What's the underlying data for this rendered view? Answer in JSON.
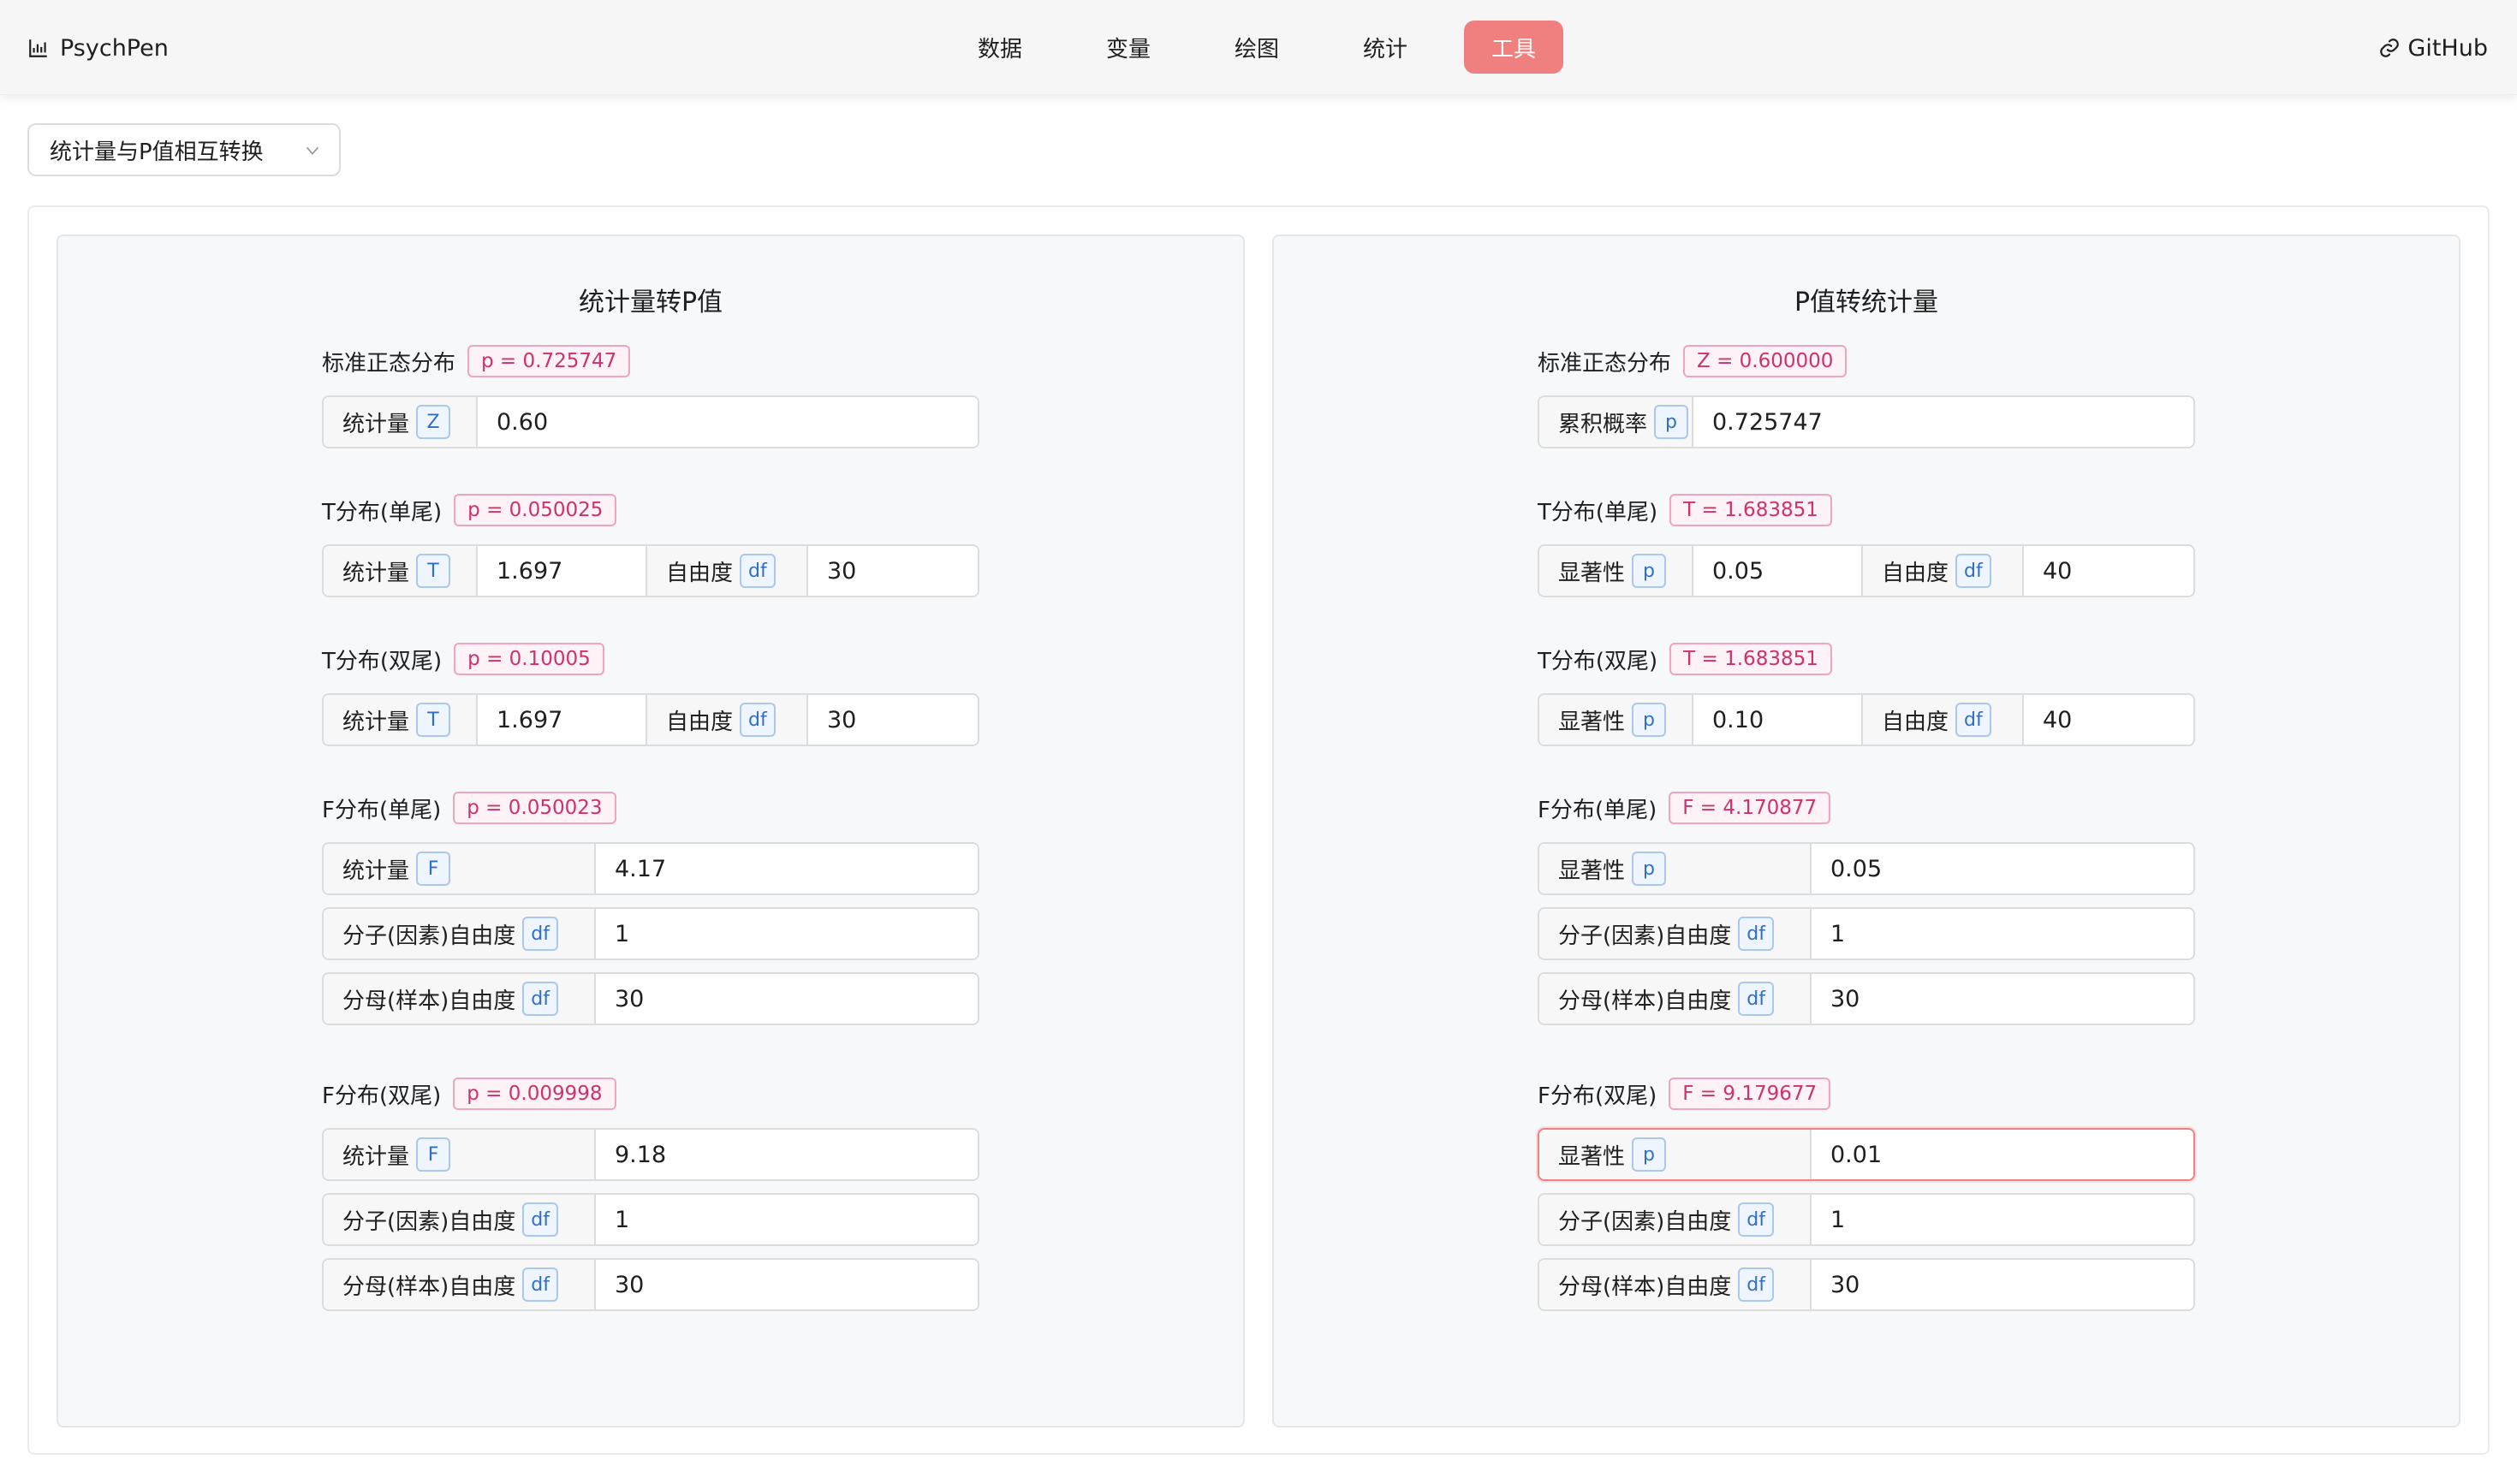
{
  "app": {
    "brand": "PsychPen",
    "github_label": "GitHub"
  },
  "nav": {
    "items": [
      {
        "label": "数据",
        "active": false
      },
      {
        "label": "变量",
        "active": false
      },
      {
        "label": "绘图",
        "active": false
      },
      {
        "label": "统计",
        "active": false
      },
      {
        "label": "工具",
        "active": true
      }
    ]
  },
  "tool_select": {
    "value": "统计量与P值相互转换"
  },
  "left": {
    "title": "统计量转P值",
    "normal": {
      "label": "标准正态分布",
      "badge": "p = 0.725747",
      "addon": "统计量",
      "tag": "Z",
      "value": "0.60"
    },
    "t_one": {
      "label": "T分布(单尾)",
      "badge": "p = 0.050025",
      "addon": "统计量",
      "tag": "T",
      "value": "1.697",
      "df_label": "自由度",
      "df_tag": "df",
      "df": "30"
    },
    "t_two": {
      "label": "T分布(双尾)",
      "badge": "p = 0.10005",
      "addon": "统计量",
      "tag": "T",
      "value": "1.697",
      "df_label": "自由度",
      "df_tag": "df",
      "df": "30"
    },
    "f_one": {
      "label": "F分布(单尾)",
      "badge": "p = 0.050023",
      "addon": "统计量",
      "tag": "F",
      "value": "4.17",
      "num_label": "分子(因素)自由度",
      "num_tag": "df",
      "num": "1",
      "den_label": "分母(样本)自由度",
      "den_tag": "df",
      "den": "30"
    },
    "f_two": {
      "label": "F分布(双尾)",
      "badge": "p = 0.009998",
      "addon": "统计量",
      "tag": "F",
      "value": "9.18",
      "num_label": "分子(因素)自由度",
      "num_tag": "df",
      "num": "1",
      "den_label": "分母(样本)自由度",
      "den_tag": "df",
      "den": "30"
    }
  },
  "right": {
    "title": "P值转统计量",
    "normal": {
      "label": "标准正态分布",
      "badge": "Z = 0.600000",
      "addon": "累积概率",
      "tag": "p",
      "value": "0.725747"
    },
    "t_one": {
      "label": "T分布(单尾)",
      "badge": "T = 1.683851",
      "addon": "显著性",
      "tag": "p",
      "value": "0.05",
      "df_label": "自由度",
      "df_tag": "df",
      "df": "40"
    },
    "t_two": {
      "label": "T分布(双尾)",
      "badge": "T = 1.683851",
      "addon": "显著性",
      "tag": "p",
      "value": "0.10",
      "df_label": "自由度",
      "df_tag": "df",
      "df": "40"
    },
    "f_one": {
      "label": "F分布(单尾)",
      "badge": "F = 4.170877",
      "addon": "显著性",
      "tag": "p",
      "value": "0.05",
      "num_label": "分子(因素)自由度",
      "num_tag": "df",
      "num": "1",
      "den_label": "分母(样本)自由度",
      "den_tag": "df",
      "den": "30"
    },
    "f_two": {
      "label": "F分布(双尾)",
      "badge": "F = 9.179677",
      "addon": "显著性",
      "tag": "p",
      "value": "0.01",
      "num_label": "分子(因素)自由度",
      "num_tag": "df",
      "num": "1",
      "den_label": "分母(样本)自由度",
      "den_tag": "df",
      "den": "30"
    }
  }
}
